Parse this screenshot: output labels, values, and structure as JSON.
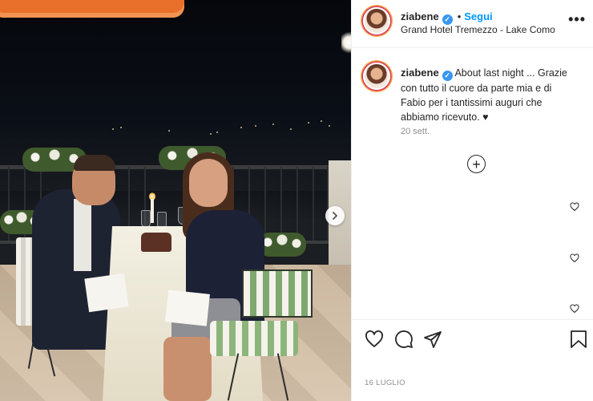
{
  "post": {
    "username": "ziabene",
    "verified_mark": "✓",
    "follow_separator": "•",
    "follow_label": "Segui",
    "location": "Grand Hotel Tremezzo - Lake Como",
    "more_label": "•••"
  },
  "caption": {
    "username": "ziabene",
    "text": " About last night ... Grazie con tutto il cuore da parte mia e di Fabio per i tantissimi auguri che abbiamo ricevuto. ♥",
    "time": "20 sett."
  },
  "comments": {
    "load_more_label": "+",
    "like_icon": "heart-outline-icon"
  },
  "footer": {
    "date": "16 LUGLIO"
  },
  "icons": {
    "like": "heart-icon",
    "comment": "comment-icon",
    "share": "send-icon",
    "save": "bookmark-icon",
    "next": "chevron-right-icon"
  },
  "colors": {
    "follow": "#0095f6",
    "verified": "#3897f0",
    "muted": "#8e8e8e",
    "text": "#262626"
  }
}
